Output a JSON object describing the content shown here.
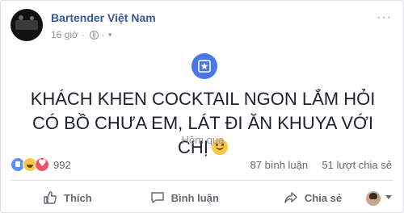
{
  "post": {
    "author": "Bartender Việt Nam",
    "time": "16 giờ",
    "dot": "·",
    "more": "···",
    "text": "KHÁCH KHEN COCKTAIL NGON LẮM HỎI CÓ BỒ CHƯA EM, LÁT ĐI ĂN KHUYA VỚI CHỊ",
    "timestamp": "Hôm qua"
  },
  "stats": {
    "reactions_count": "992",
    "comments": "87 bình luận",
    "shares": "51 lượt chia sẻ",
    "reaction_types": [
      "like",
      "haha",
      "love"
    ]
  },
  "actions": {
    "like": "Thích",
    "comment": "Bình luận",
    "share": "Chia sẻ"
  },
  "colors": {
    "author": "#365899",
    "badge": "#4a76e8",
    "muted": "#90949c"
  }
}
